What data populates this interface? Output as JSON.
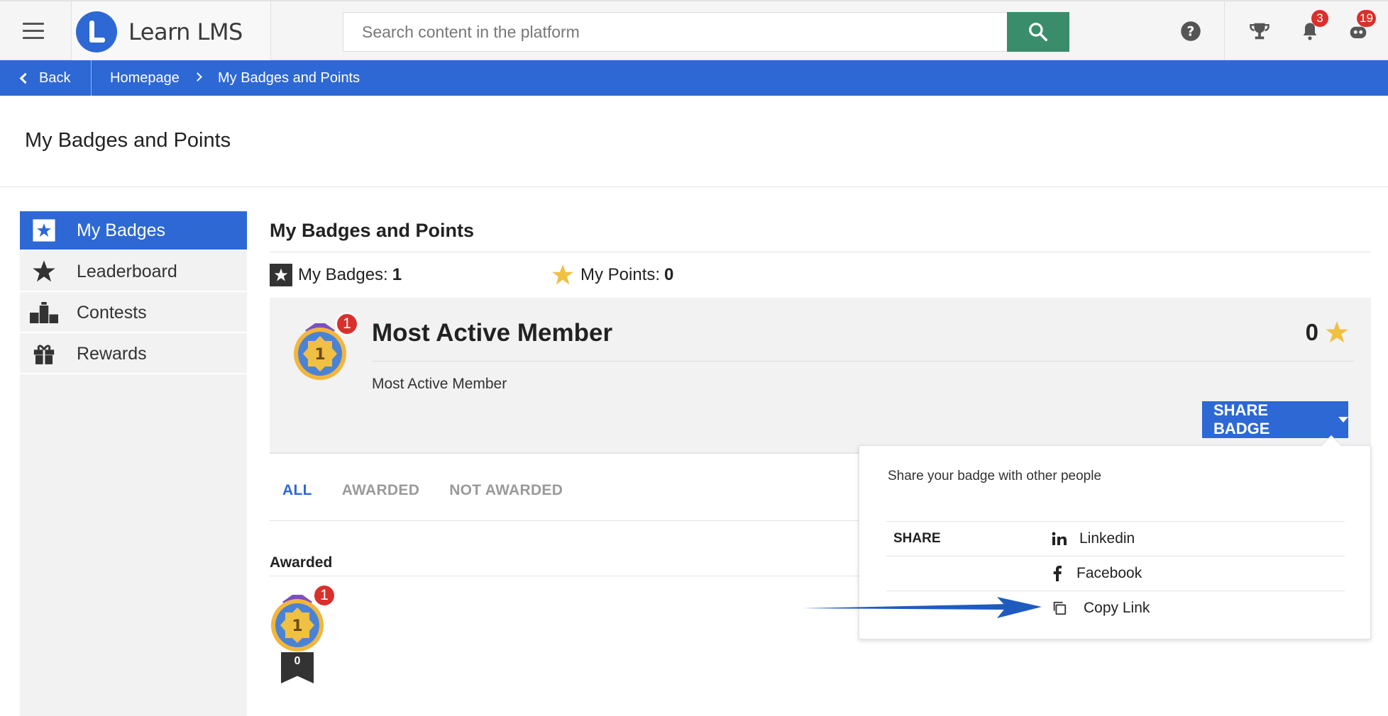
{
  "topbar": {
    "logo_text": "Learn LMS",
    "search_placeholder": "Search content in the platform",
    "notifications_count": "3",
    "messages_count": "19"
  },
  "breadcrumb": {
    "back_label": "Back",
    "items": [
      "Homepage",
      "My Badges and Points"
    ]
  },
  "page_title": "My Badges and Points",
  "sidebar": {
    "items": [
      {
        "label": "My Badges",
        "icon": "star-square-icon",
        "active": true
      },
      {
        "label": "Leaderboard",
        "icon": "star-icon",
        "active": false
      },
      {
        "label": "Contests",
        "icon": "podium-icon",
        "active": false
      },
      {
        "label": "Rewards",
        "icon": "gift-icon",
        "active": false
      }
    ]
  },
  "main": {
    "heading": "My Badges and Points",
    "my_badges_label": "My Badges:",
    "my_badges_value": "1",
    "my_points_label": "My Points:",
    "my_points_value": "0"
  },
  "badge_card": {
    "title": "Most Active Member",
    "description": "Most Active Member",
    "points": "0",
    "medal_number": "1",
    "medal_count_badge": "1",
    "share_button_label": "SHARE BADGE"
  },
  "tabs": [
    "ALL",
    "AWARDED",
    "NOT AWARDED"
  ],
  "awarded": {
    "title": "Awarded",
    "medal_count_badge": "1",
    "ribbon_points": "0"
  },
  "share_popover": {
    "text": "Share your badge with other people",
    "share_label": "SHARE",
    "items": [
      "Linkedin",
      "Facebook",
      "Copy Link"
    ]
  },
  "colors": {
    "brand_blue": "#2d68d4",
    "search_green": "#3a8d6a",
    "badge_red": "#d9302c",
    "star_gold": "#f0c043"
  }
}
